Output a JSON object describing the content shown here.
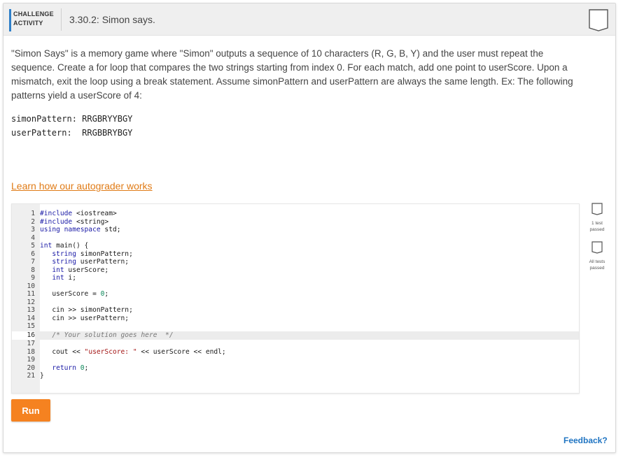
{
  "header": {
    "badge_line1": "CHALLENGE",
    "badge_line2": "ACTIVITY",
    "title": "3.30.2: Simon says.",
    "accent_color": "#2e7fc9"
  },
  "description": "\"Simon Says\" is a memory game where \"Simon\" outputs a sequence of 10 characters (R, G, B, Y) and the user must repeat the sequence. Create a for loop that compares the two strings starting from index 0. For each match, add one point to userScore. Upon a mismatch, exit the loop using a break statement. Assume simonPattern and userPattern are always the same length. Ex: The following patterns yield a userScore of 4:",
  "patterns": {
    "simon": "simonPattern: RRGBRYYBGY",
    "user": "userPattern:  RRGBBRYBGY"
  },
  "learn_link": "Learn how our autograder works",
  "code": {
    "line_numbers": [
      "1",
      "2",
      "3",
      "4",
      "5",
      "6",
      "7",
      "8",
      "9",
      "10",
      "11",
      "12",
      "13",
      "14",
      "15",
      "16",
      "17",
      "18",
      "19",
      "20",
      "21"
    ],
    "active_line": 16
  },
  "status": {
    "test1_line1": "1 test",
    "test1_line2": "passed",
    "all_line1": "All tests",
    "all_line2": "passed"
  },
  "run_button": "Run",
  "feedback": "Feedback?",
  "colors": {
    "run": "#f58220",
    "link": "#e07b16",
    "feedback": "#1f74c2"
  }
}
